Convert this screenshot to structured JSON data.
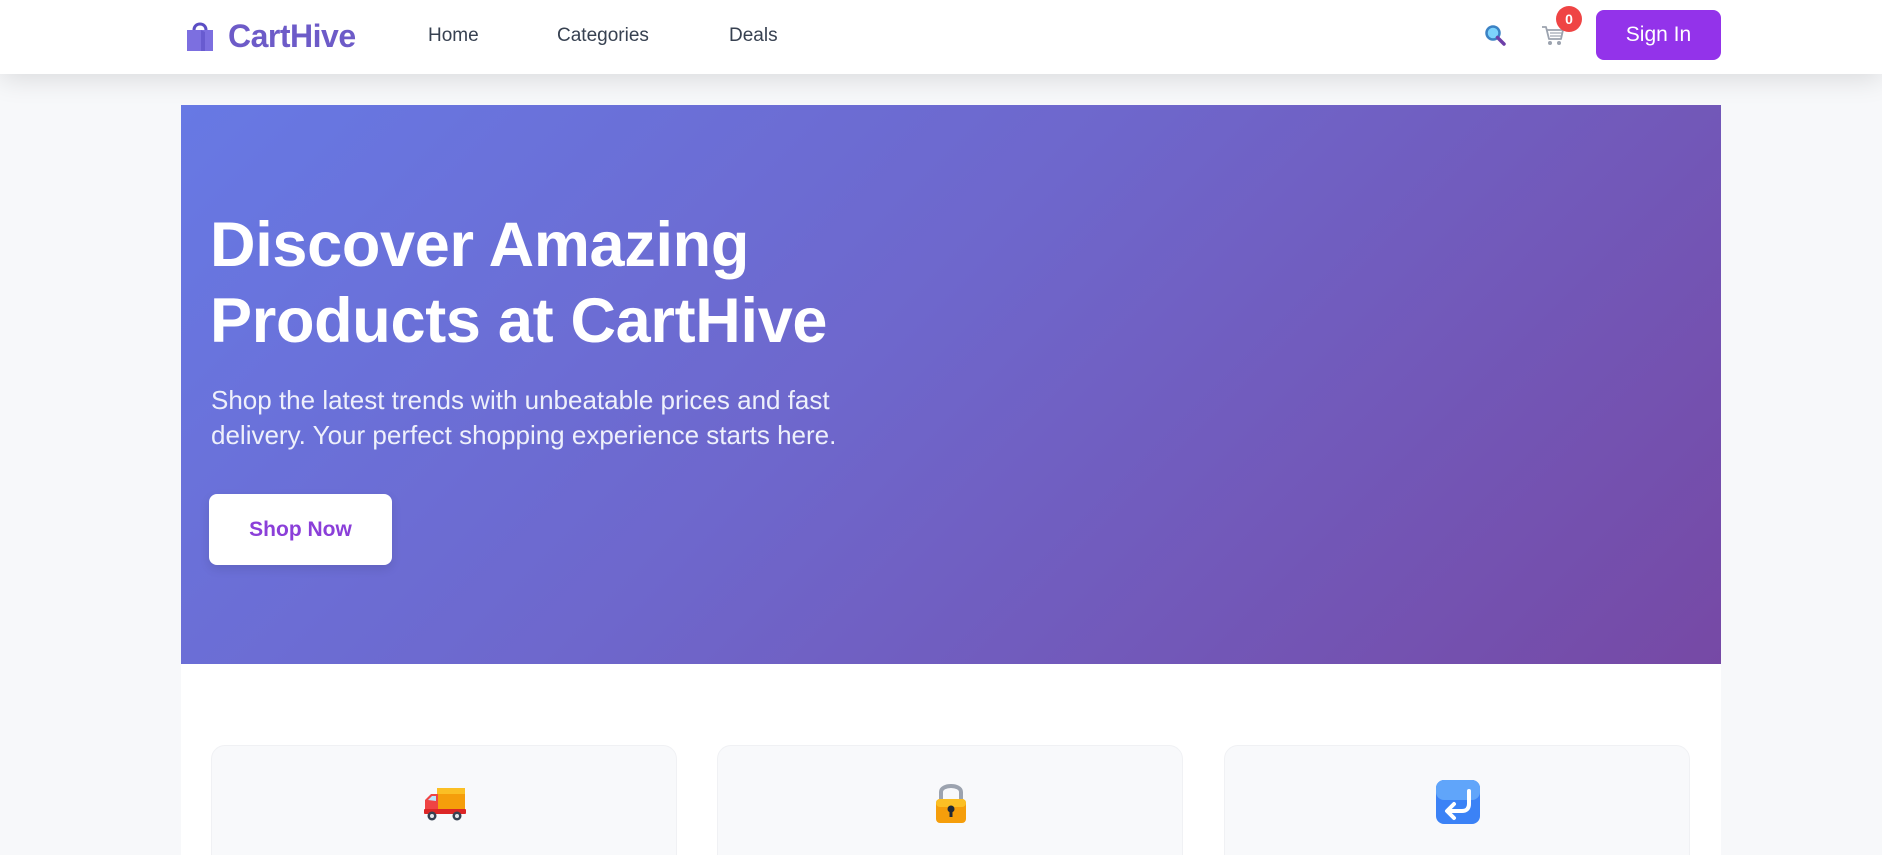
{
  "brand": {
    "name": "CartHive",
    "color": "#6d5bc8"
  },
  "nav": {
    "links": [
      {
        "label": "Home"
      },
      {
        "label": "Categories"
      },
      {
        "label": "Deals"
      }
    ],
    "icons": {
      "search": "search-icon",
      "cart": "cart-icon",
      "logo": "shopping-bag-icon"
    },
    "cart_count": "0",
    "sign_in_label": "Sign In"
  },
  "hero": {
    "title_line1": "Discover Amazing",
    "title_line2": "Products at CartHive",
    "subtitle": "Shop the latest trends with unbeatable prices and fast delivery. Your perfect shopping experience starts here.",
    "cta_label": "Shop Now",
    "gradient": [
      "#6779e4",
      "#7649a5"
    ]
  },
  "features": [
    {
      "icon": "delivery-truck-icon"
    },
    {
      "icon": "lock-icon"
    },
    {
      "icon": "return-arrow-icon"
    }
  ],
  "colors": {
    "accent": "#9333ea",
    "badge": "#ef4444",
    "cta_text": "#8b3fd9"
  }
}
